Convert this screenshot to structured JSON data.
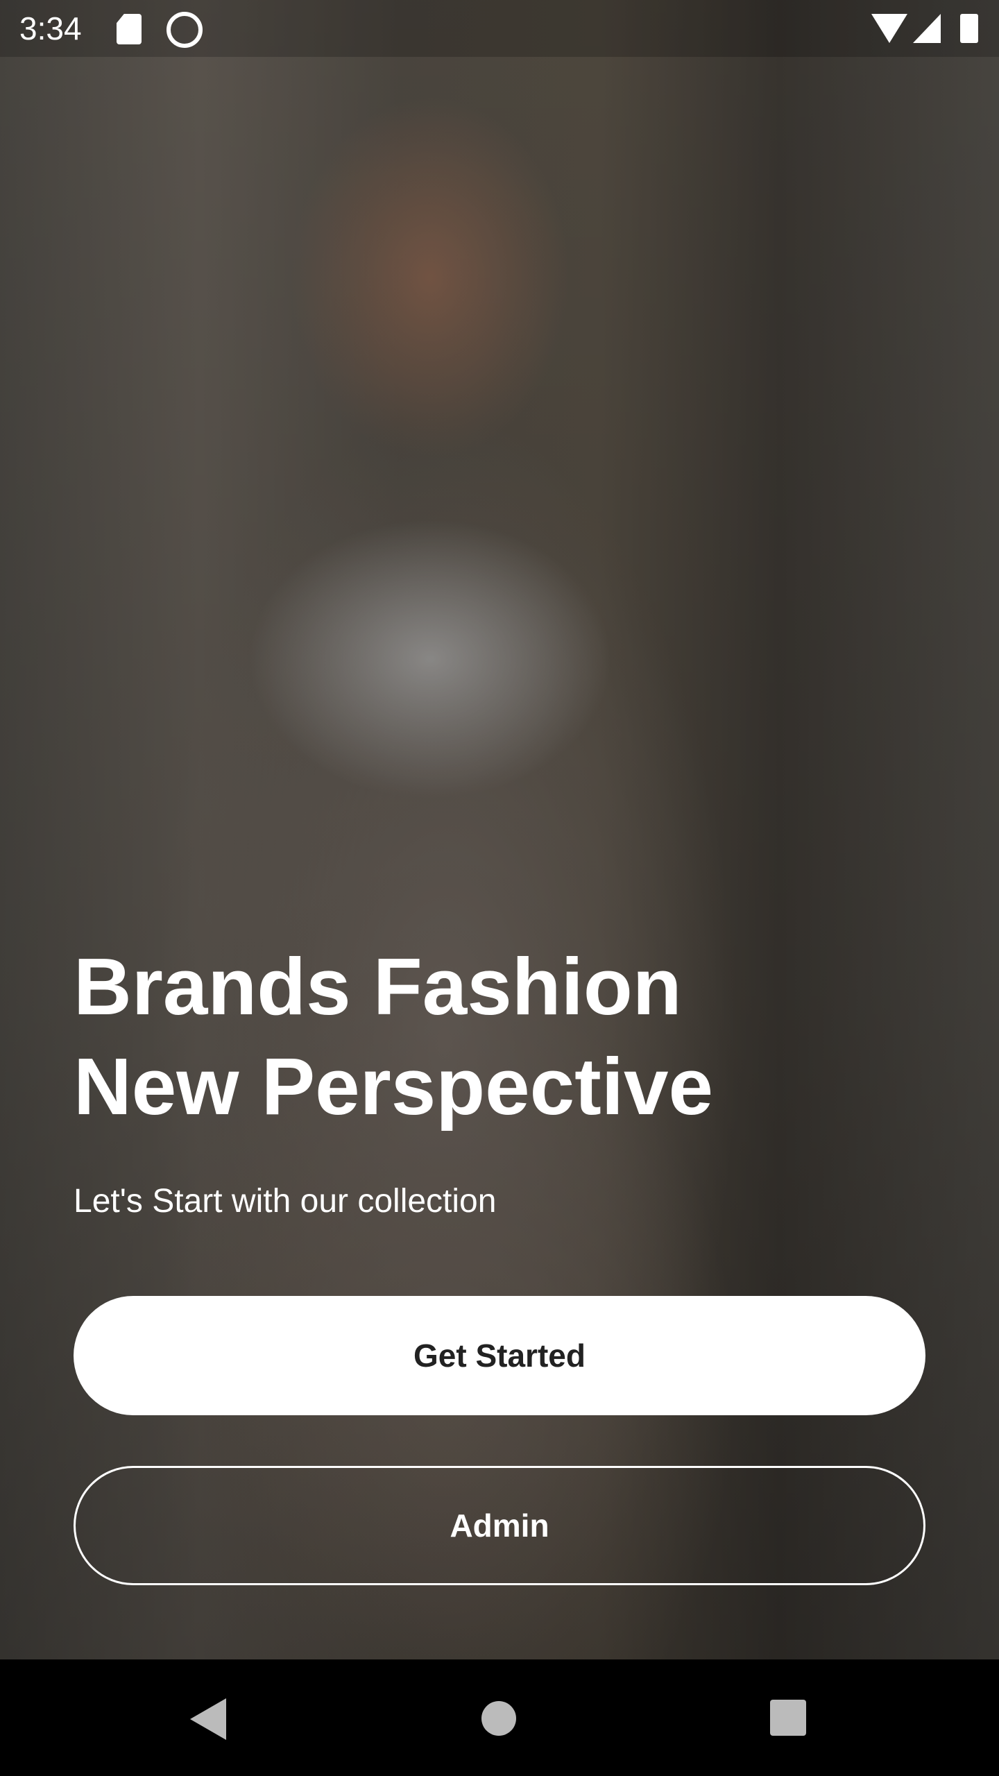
{
  "status_bar": {
    "time": "3:34",
    "icons": [
      "sd-card-icon",
      "sync-icon",
      "wifi-icon",
      "signal-icon",
      "battery-icon"
    ]
  },
  "hero": {
    "title_line1": "Brands Fashion",
    "title_line2": "New Perspective",
    "subtitle": "Let's Start with our collection"
  },
  "buttons": {
    "get_started": "Get Started",
    "admin": "Admin"
  },
  "nav_bar": {
    "icons": [
      "back-icon",
      "home-icon",
      "recents-icon"
    ]
  }
}
